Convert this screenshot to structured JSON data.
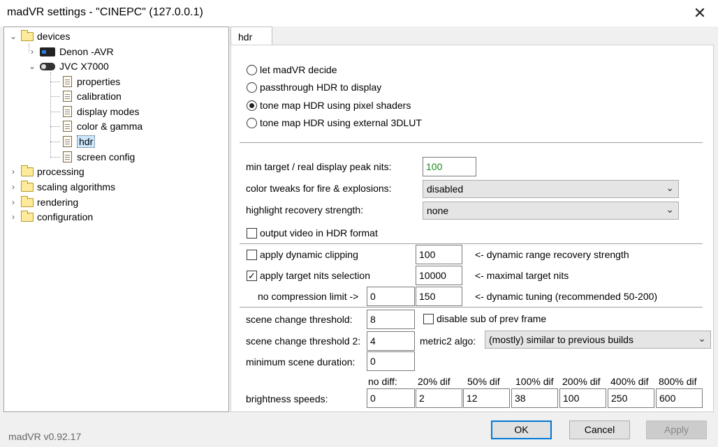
{
  "window": {
    "title": "madVR settings - \"CINEPC\" (127.0.0.1)",
    "close_glyph": "✕"
  },
  "tree": {
    "devices": "devices",
    "denon": "Denon -AVR",
    "jvc": "JVC X7000",
    "jvc_children": [
      "properties",
      "calibration",
      "display modes",
      "color & gamma",
      "hdr",
      "screen config"
    ],
    "processing": "processing",
    "scaling": "scaling algorithms",
    "rendering": "rendering",
    "configuration": "configuration"
  },
  "tab": {
    "label": "hdr"
  },
  "hdr_mode": {
    "options": [
      "let madVR decide",
      "passthrough HDR to display",
      "tone map HDR using pixel shaders",
      "tone map HDR using external 3DLUT"
    ],
    "selected_index": 2
  },
  "settings": {
    "min_target_label": "min target / real display peak nits:",
    "min_target_value": "100",
    "color_tweaks_label": "color tweaks for fire & explosions:",
    "color_tweaks_value": "disabled",
    "highlight_label": "highlight recovery strength:",
    "highlight_value": "none",
    "output_hdr_label": "output video in HDR format",
    "dyn_clip_label": "apply dynamic clipping",
    "dyn_clip_value": "100",
    "dyn_clip_note": "<- dynamic range recovery strength",
    "target_nits_label": "apply target nits selection",
    "target_nits_value": "10000",
    "target_nits_note": "<- maximal target nits",
    "no_comp_label": "no compression limit ->",
    "no_comp_value": "0",
    "dyn_tuning_value": "150",
    "dyn_tuning_note": "<- dynamic tuning (recommended 50-200)",
    "scene_thr_label": "scene change threshold:",
    "scene_thr_value": "8",
    "disable_sub_label": "disable sub of prev frame",
    "scene_thr2_label": "scene change threshold 2:",
    "scene_thr2_value": "4",
    "metric2_label": "metric2 algo:",
    "metric2_value": "(mostly) similar to previous builds",
    "min_scene_label": "minimum scene duration:",
    "min_scene_value": "0"
  },
  "brightness": {
    "label": "brightness speeds:",
    "headers": [
      "no diff:",
      "20% dif",
      "50% dif",
      "100% dif",
      "200% dif",
      "400% dif",
      "800% dif"
    ],
    "values": [
      "0",
      "2",
      "12",
      "38",
      "100",
      "250",
      "600"
    ]
  },
  "footer": {
    "version": "madVR v0.92.17",
    "ok": "OK",
    "cancel": "Cancel",
    "apply": "Apply"
  },
  "colors": {
    "accent": "#0078d7",
    "selection": "#cce8ff",
    "nits_value": "#1a8a1a"
  }
}
